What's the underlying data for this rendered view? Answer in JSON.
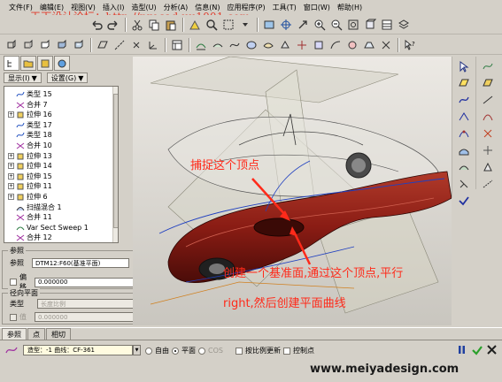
{
  "menu": [
    "文件(F)",
    "编辑(E)",
    "视图(V)",
    "插入(I)",
    "造型(U)",
    "分析(A)",
    "信息(N)",
    "应用程序(P)",
    "工具(T)",
    "窗口(W)",
    "帮助(H)"
  ],
  "watermark": {
    "site": "天下设计论坛：",
    "url": "http://procad.uu1001.com"
  },
  "left_panel": {
    "display_label": "显示(I)",
    "settings_label": "设置(G)",
    "tree": [
      {
        "label": "类型 15",
        "expand": false,
        "icon": "curve-feature-icon"
      },
      {
        "label": "合并 7",
        "expand": false,
        "icon": "merge-icon"
      },
      {
        "label": "拉伸 16",
        "expand": true,
        "icon": "extrude-icon"
      },
      {
        "label": "类型 17",
        "expand": false,
        "icon": "curve-feature-icon"
      },
      {
        "label": "类型 18",
        "expand": false,
        "icon": "curve-feature-icon"
      },
      {
        "label": "合并 10",
        "expand": false,
        "icon": "merge-icon"
      },
      {
        "label": "拉伸 13",
        "expand": true,
        "icon": "extrude-icon"
      },
      {
        "label": "拉伸 14",
        "expand": true,
        "icon": "extrude-icon"
      },
      {
        "label": "拉伸 15",
        "expand": true,
        "icon": "extrude-icon"
      },
      {
        "label": "拉伸 11",
        "expand": true,
        "icon": "extrude-icon"
      },
      {
        "label": "拉伸 6",
        "expand": true,
        "icon": "extrude-icon"
      },
      {
        "label": "扫描混合 1",
        "expand": false,
        "icon": "swept-blend-icon"
      },
      {
        "label": "合并 11",
        "expand": false,
        "icon": "merge-icon"
      },
      {
        "label": "Var Sect Sweep 1",
        "expand": false,
        "icon": "var-sweep-icon"
      },
      {
        "label": "合并 12",
        "expand": false,
        "icon": "merge-icon"
      }
    ],
    "reference_group": {
      "title": "参照",
      "ref_label": "参照",
      "ref_value": "DTM12:F60(基准平面)",
      "offset_label": "偏移",
      "offset_value": "0.000000"
    },
    "radial_group": {
      "title": "径向平面",
      "type_label": "类型",
      "type_value": "长度比例",
      "value_label": "值",
      "value_value": "0.000000"
    }
  },
  "annotations": {
    "capture_vertex": "捕捉这个顶点",
    "instruction_line1": "创建一个基准面,通过这个顶点,平行",
    "instruction_line2": "right,然后创建平面曲线"
  },
  "bottom_tabs": [
    "参照",
    "点",
    "相切"
  ],
  "dashboard": {
    "curve_field": "造型：-1 曲线：CF-361",
    "free_label": "自由",
    "plane_label": "平面",
    "cos_label": "COS",
    "plane_selected": true,
    "scale_update_label": "按比例更新",
    "control_points_label": "控制点"
  },
  "footer_url": "www.meiyadesign.com",
  "colors": {
    "annotation": "#ff2a1a",
    "car_body": "#8a1c14",
    "accept": "#2aa02a"
  }
}
